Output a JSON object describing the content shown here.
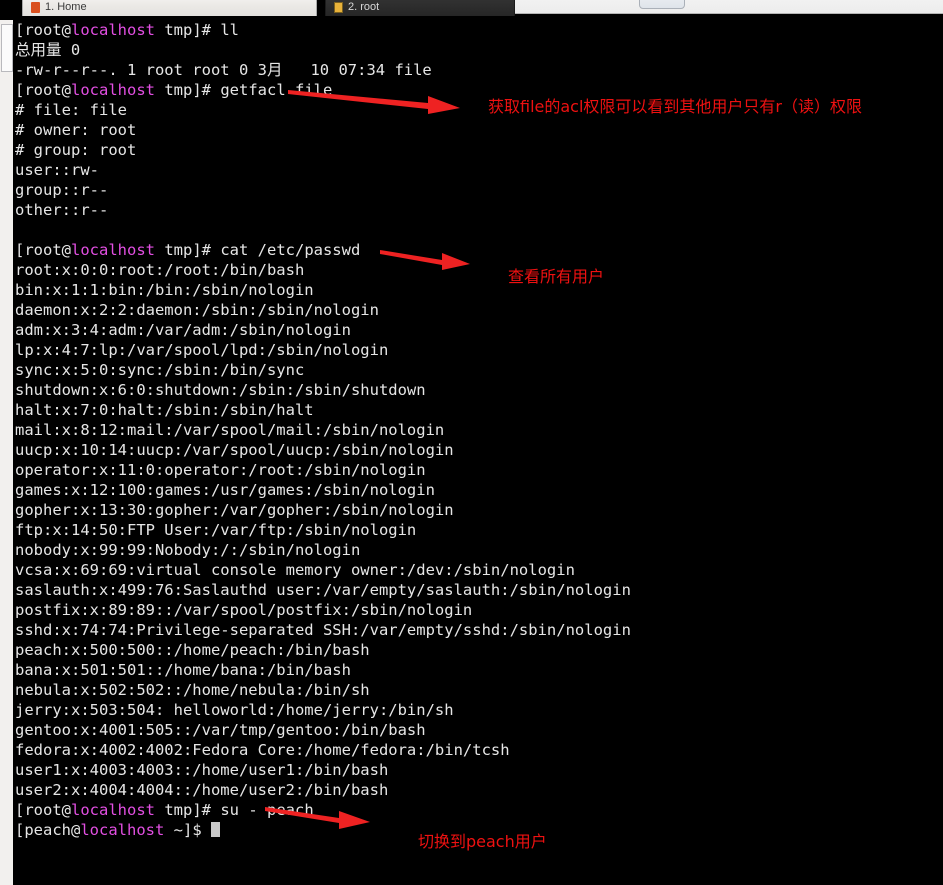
{
  "window": {
    "tabs": [
      {
        "label": "1. Home",
        "icon": "home-icon",
        "active": true
      },
      {
        "label": "2. root",
        "icon": "terminal-icon",
        "active": false
      }
    ],
    "new_tab_label": "+"
  },
  "terminal": {
    "prompt_user_root": "[root@",
    "prompt_host": "localhost",
    "prompt_tail_root": " tmp]# ",
    "prompt_user_peach": "[peach@",
    "prompt_tail_peach": " ~]$ ",
    "lines": [
      {
        "type": "prompt",
        "user": "[root@",
        "host": "localhost",
        "tail": " tmp]# ",
        "cmd": "ll"
      },
      {
        "type": "out",
        "text": "总用量 0"
      },
      {
        "type": "out",
        "text": "-rw-r--r--. 1 root root 0 3月   10 07:34 file"
      },
      {
        "type": "prompt",
        "user": "[root@",
        "host": "localhost",
        "tail": " tmp]# ",
        "cmd": "getfacl file"
      },
      {
        "type": "out",
        "text": "# file: file"
      },
      {
        "type": "out",
        "text": "# owner: root"
      },
      {
        "type": "out",
        "text": "# group: root"
      },
      {
        "type": "out",
        "text": "user::rw-"
      },
      {
        "type": "out",
        "text": "group::r--"
      },
      {
        "type": "out",
        "text": "other::r--"
      },
      {
        "type": "out",
        "text": ""
      },
      {
        "type": "prompt",
        "user": "[root@",
        "host": "localhost",
        "tail": " tmp]# ",
        "cmd": "cat /etc/passwd"
      },
      {
        "type": "out",
        "text": "root:x:0:0:root:/root:/bin/bash"
      },
      {
        "type": "out",
        "text": "bin:x:1:1:bin:/bin:/sbin/nologin"
      },
      {
        "type": "out",
        "text": "daemon:x:2:2:daemon:/sbin:/sbin/nologin"
      },
      {
        "type": "out",
        "text": "adm:x:3:4:adm:/var/adm:/sbin/nologin"
      },
      {
        "type": "out",
        "text": "lp:x:4:7:lp:/var/spool/lpd:/sbin/nologin"
      },
      {
        "type": "out",
        "text": "sync:x:5:0:sync:/sbin:/bin/sync"
      },
      {
        "type": "out",
        "text": "shutdown:x:6:0:shutdown:/sbin:/sbin/shutdown"
      },
      {
        "type": "out",
        "text": "halt:x:7:0:halt:/sbin:/sbin/halt"
      },
      {
        "type": "out",
        "text": "mail:x:8:12:mail:/var/spool/mail:/sbin/nologin"
      },
      {
        "type": "out",
        "text": "uucp:x:10:14:uucp:/var/spool/uucp:/sbin/nologin"
      },
      {
        "type": "out",
        "text": "operator:x:11:0:operator:/root:/sbin/nologin"
      },
      {
        "type": "out",
        "text": "games:x:12:100:games:/usr/games:/sbin/nologin"
      },
      {
        "type": "out",
        "text": "gopher:x:13:30:gopher:/var/gopher:/sbin/nologin"
      },
      {
        "type": "out",
        "text": "ftp:x:14:50:FTP User:/var/ftp:/sbin/nologin"
      },
      {
        "type": "out",
        "text": "nobody:x:99:99:Nobody:/:/sbin/nologin"
      },
      {
        "type": "out",
        "text": "vcsa:x:69:69:virtual console memory owner:/dev:/sbin/nologin"
      },
      {
        "type": "out",
        "text": "saslauth:x:499:76:Saslauthd user:/var/empty/saslauth:/sbin/nologin"
      },
      {
        "type": "out",
        "text": "postfix:x:89:89::/var/spool/postfix:/sbin/nologin"
      },
      {
        "type": "out",
        "text": "sshd:x:74:74:Privilege-separated SSH:/var/empty/sshd:/sbin/nologin"
      },
      {
        "type": "out",
        "text": "peach:x:500:500::/home/peach:/bin/bash"
      },
      {
        "type": "out",
        "text": "bana:x:501:501::/home/bana:/bin/bash"
      },
      {
        "type": "out",
        "text": "nebula:x:502:502::/home/nebula:/bin/sh"
      },
      {
        "type": "out",
        "text": "jerry:x:503:504: helloworld:/home/jerry:/bin/sh"
      },
      {
        "type": "out",
        "text": "gentoo:x:4001:505::/var/tmp/gentoo:/bin/bash"
      },
      {
        "type": "out",
        "text": "fedora:x:4002:4002:Fedora Core:/home/fedora:/bin/tcsh"
      },
      {
        "type": "out",
        "text": "user1:x:4003:4003::/home/user1:/bin/bash"
      },
      {
        "type": "out",
        "text": "user2:x:4004:4004::/home/user2:/bin/bash"
      },
      {
        "type": "prompt",
        "user": "[root@",
        "host": "localhost",
        "tail": " tmp]# ",
        "cmd": "su - peach"
      },
      {
        "type": "prompt-cursor",
        "user": "[peach@",
        "host": "localhost",
        "tail": " ~]$ ",
        "cmd": ""
      }
    ]
  },
  "annotations": [
    {
      "id": "annot-1",
      "text": "获取file的acl权限可以看到其他用户只有r（读）权限",
      "color": "#ee1111"
    },
    {
      "id": "annot-2",
      "text": "查看所有用户",
      "color": "#ee1111"
    },
    {
      "id": "annot-3",
      "text": "切换到peach用户",
      "color": "#ee1111"
    }
  ],
  "colors": {
    "terminal_bg": "#000000",
    "terminal_fg": "#e6e6e6",
    "hostname": "#e24fe2",
    "annotation_red": "#ee1111",
    "arrow_red": "#ee2222"
  }
}
